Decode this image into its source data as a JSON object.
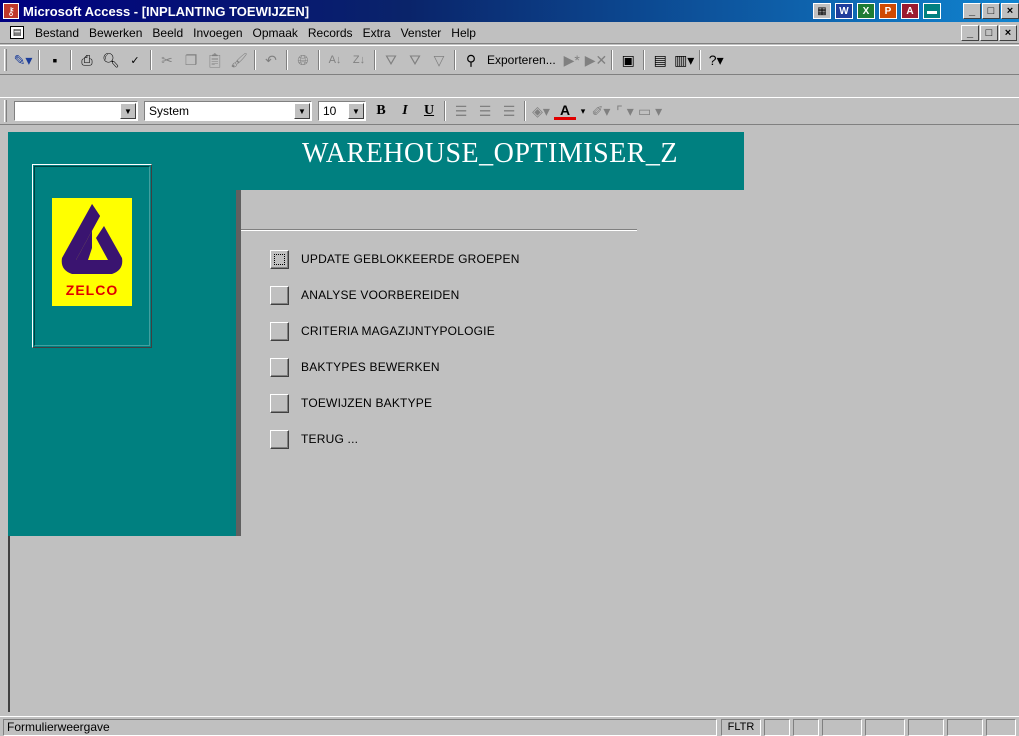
{
  "window": {
    "title": "Microsoft Access - [INPLANTING TOEWIJZEN]",
    "app_icon": "access-icon",
    "taskbar_icons": [
      "office-shortcut-icon",
      "word-icon",
      "excel-icon",
      "powerpoint-icon",
      "access-icon",
      "desktop-icon"
    ],
    "controls": {
      "minimize": "_",
      "maximize": "□",
      "close": "×"
    }
  },
  "menubar": {
    "items": [
      {
        "label": "Bestand",
        "underline": "B"
      },
      {
        "label": "Bewerken",
        "underline": "w"
      },
      {
        "label": "Beeld",
        "underline": "l"
      },
      {
        "label": "Invoegen",
        "underline": "I"
      },
      {
        "label": "Opmaak",
        "underline": "k"
      },
      {
        "label": "Records",
        "underline": "R"
      },
      {
        "label": "Extra",
        "underline": "x"
      },
      {
        "label": "Venster",
        "underline": "V"
      },
      {
        "label": "Help",
        "underline": "H"
      }
    ]
  },
  "toolbar1": {
    "buttons": [
      "view-icon",
      "save-icon",
      "print-icon",
      "print-preview-icon",
      "spelling-icon",
      "cut-icon",
      "copy-icon",
      "paste-icon",
      "format-painter-icon",
      "undo-icon",
      "hyperlink-icon",
      "sort-ascending-icon",
      "sort-descending-icon",
      "filter-by-selection-icon",
      "filter-by-form-icon",
      "apply-filter-icon",
      "find-icon"
    ],
    "export_label": "Exporteren...",
    "buttons_after": [
      "new-record-icon",
      "delete-record-icon",
      "properties-icon",
      "database-window-icon",
      "new-object-icon",
      "help-icon"
    ]
  },
  "toolbar2": {
    "object_combo": "",
    "font_combo": "System",
    "size_combo": "10",
    "bold": "B",
    "italic": "I",
    "underline": "U"
  },
  "form": {
    "title": "WAREHOUSE_OPTIMISER_Z",
    "logo_text": "ZELCO",
    "colors": {
      "teal": "#008080",
      "logo_yellow": "#ffff00",
      "logo_purple": "#3a1470",
      "logo_red": "#e00000"
    },
    "menu": [
      {
        "label": "UPDATE GEBLOKKEERDE GROEPEN",
        "focused": true
      },
      {
        "label": "ANALYSE VOORBEREIDEN"
      },
      {
        "label": "CRITERIA MAGAZIJNTYPOLOGIE"
      },
      {
        "label": "BAKTYPES BEWERKEN"
      },
      {
        "label": "TOEWIJZEN BAKTYPE"
      },
      {
        "label": "TERUG ..."
      }
    ]
  },
  "statusbar": {
    "text": "Formulierweergave",
    "indicators": [
      "FLTR",
      "",
      "",
      "",
      "",
      "",
      "",
      "",
      ""
    ]
  }
}
